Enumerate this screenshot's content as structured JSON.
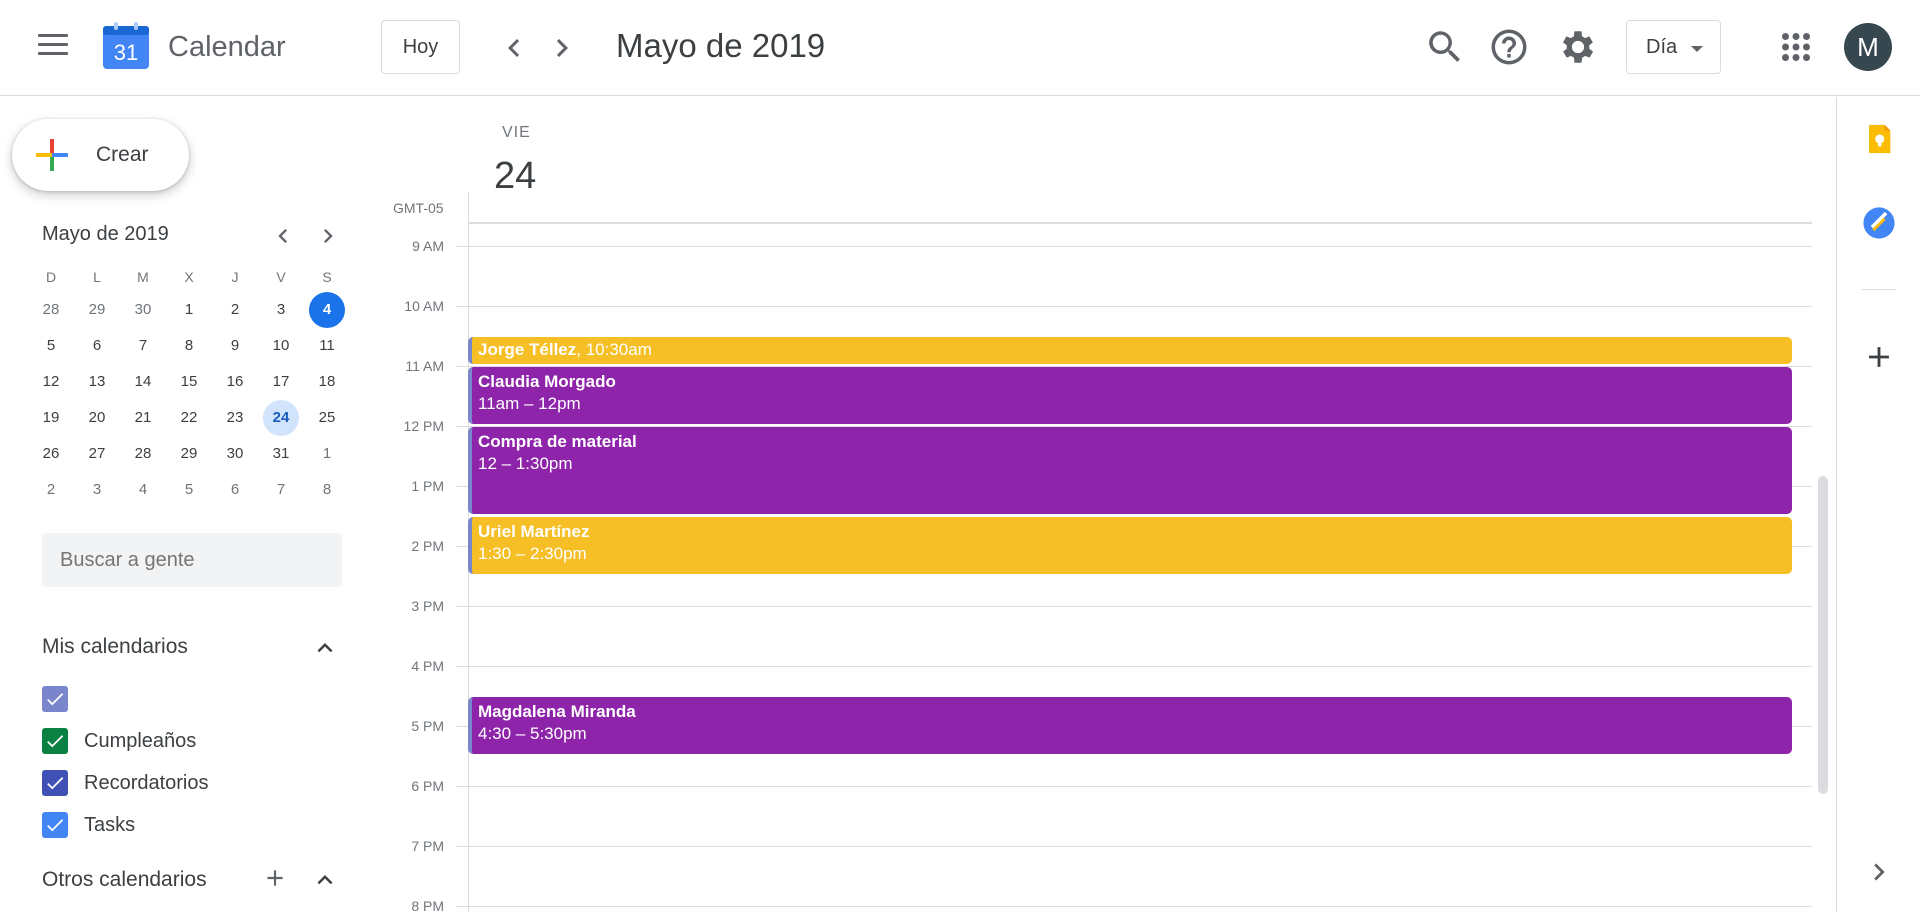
{
  "header": {
    "app_name": "Calendar",
    "logo_day": "31",
    "today_label": "Hoy",
    "period_title": "Mayo de 2019",
    "view_label": "Día",
    "avatar_initial": "M"
  },
  "sidebar": {
    "create_label": "Crear",
    "mini_calendar": {
      "title": "Mayo de 2019",
      "days_of_week": [
        "D",
        "L",
        "M",
        "X",
        "J",
        "V",
        "S"
      ],
      "weeks": [
        [
          "28",
          "29",
          "30",
          "1",
          "2",
          "3",
          "4"
        ],
        [
          "5",
          "6",
          "7",
          "8",
          "9",
          "10",
          "11"
        ],
        [
          "12",
          "13",
          "14",
          "15",
          "16",
          "17",
          "18"
        ],
        [
          "19",
          "20",
          "21",
          "22",
          "23",
          "24",
          "25"
        ],
        [
          "26",
          "27",
          "28",
          "29",
          "30",
          "31",
          "1"
        ],
        [
          "2",
          "3",
          "4",
          "5",
          "6",
          "7",
          "8"
        ]
      ],
      "today": "4",
      "selected": "24"
    },
    "search_placeholder": "Buscar a gente",
    "my_calendars_title": "Mis calendarios",
    "my_calendars": [
      {
        "name": "",
        "color": "#7986cb"
      },
      {
        "name": "Cumpleaños",
        "color": "#0b8043"
      },
      {
        "name": "Recordatorios",
        "color": "#3f51b5"
      },
      {
        "name": "Tasks",
        "color": "#4285f4"
      }
    ],
    "other_calendars_title": "Otros calendarios"
  },
  "main": {
    "day_of_week": "VIE",
    "day_number": "24",
    "timezone": "GMT-05",
    "hours": [
      "9 AM",
      "10 AM",
      "11 AM",
      "12 PM",
      "1 PM",
      "2 PM",
      "3 PM",
      "4 PM",
      "5 PM",
      "6 PM",
      "7 PM",
      "8 PM"
    ],
    "events": [
      {
        "title": "Jorge Téllez",
        "time": ", 10:30am",
        "color": "yellow",
        "inline": true
      },
      {
        "title": "Claudia Morgado",
        "time": "11am – 12pm",
        "color": "purple"
      },
      {
        "title": "Compra de material",
        "time": "12 – 1:30pm",
        "color": "purple"
      },
      {
        "title": "Uriel Martínez",
        "time": "1:30 – 2:30pm",
        "color": "yellow"
      },
      {
        "title": "Magdalena Miranda",
        "time": "4:30 – 5:30pm",
        "color": "purple"
      }
    ]
  },
  "colors": {
    "accent": "#1a73e8",
    "event_yellow": "#f6bf26",
    "event_purple": "#8e24aa"
  },
  "icons": {
    "header": [
      "menu-icon",
      "calendar-logo-icon",
      "chevron-left-icon",
      "chevron-right-icon",
      "search-icon",
      "help-icon",
      "settings-icon",
      "apps-grid-icon"
    ],
    "side_panel": [
      "keep-icon",
      "tasks-icon",
      "plus-icon",
      "chevron-right-icon"
    ]
  }
}
